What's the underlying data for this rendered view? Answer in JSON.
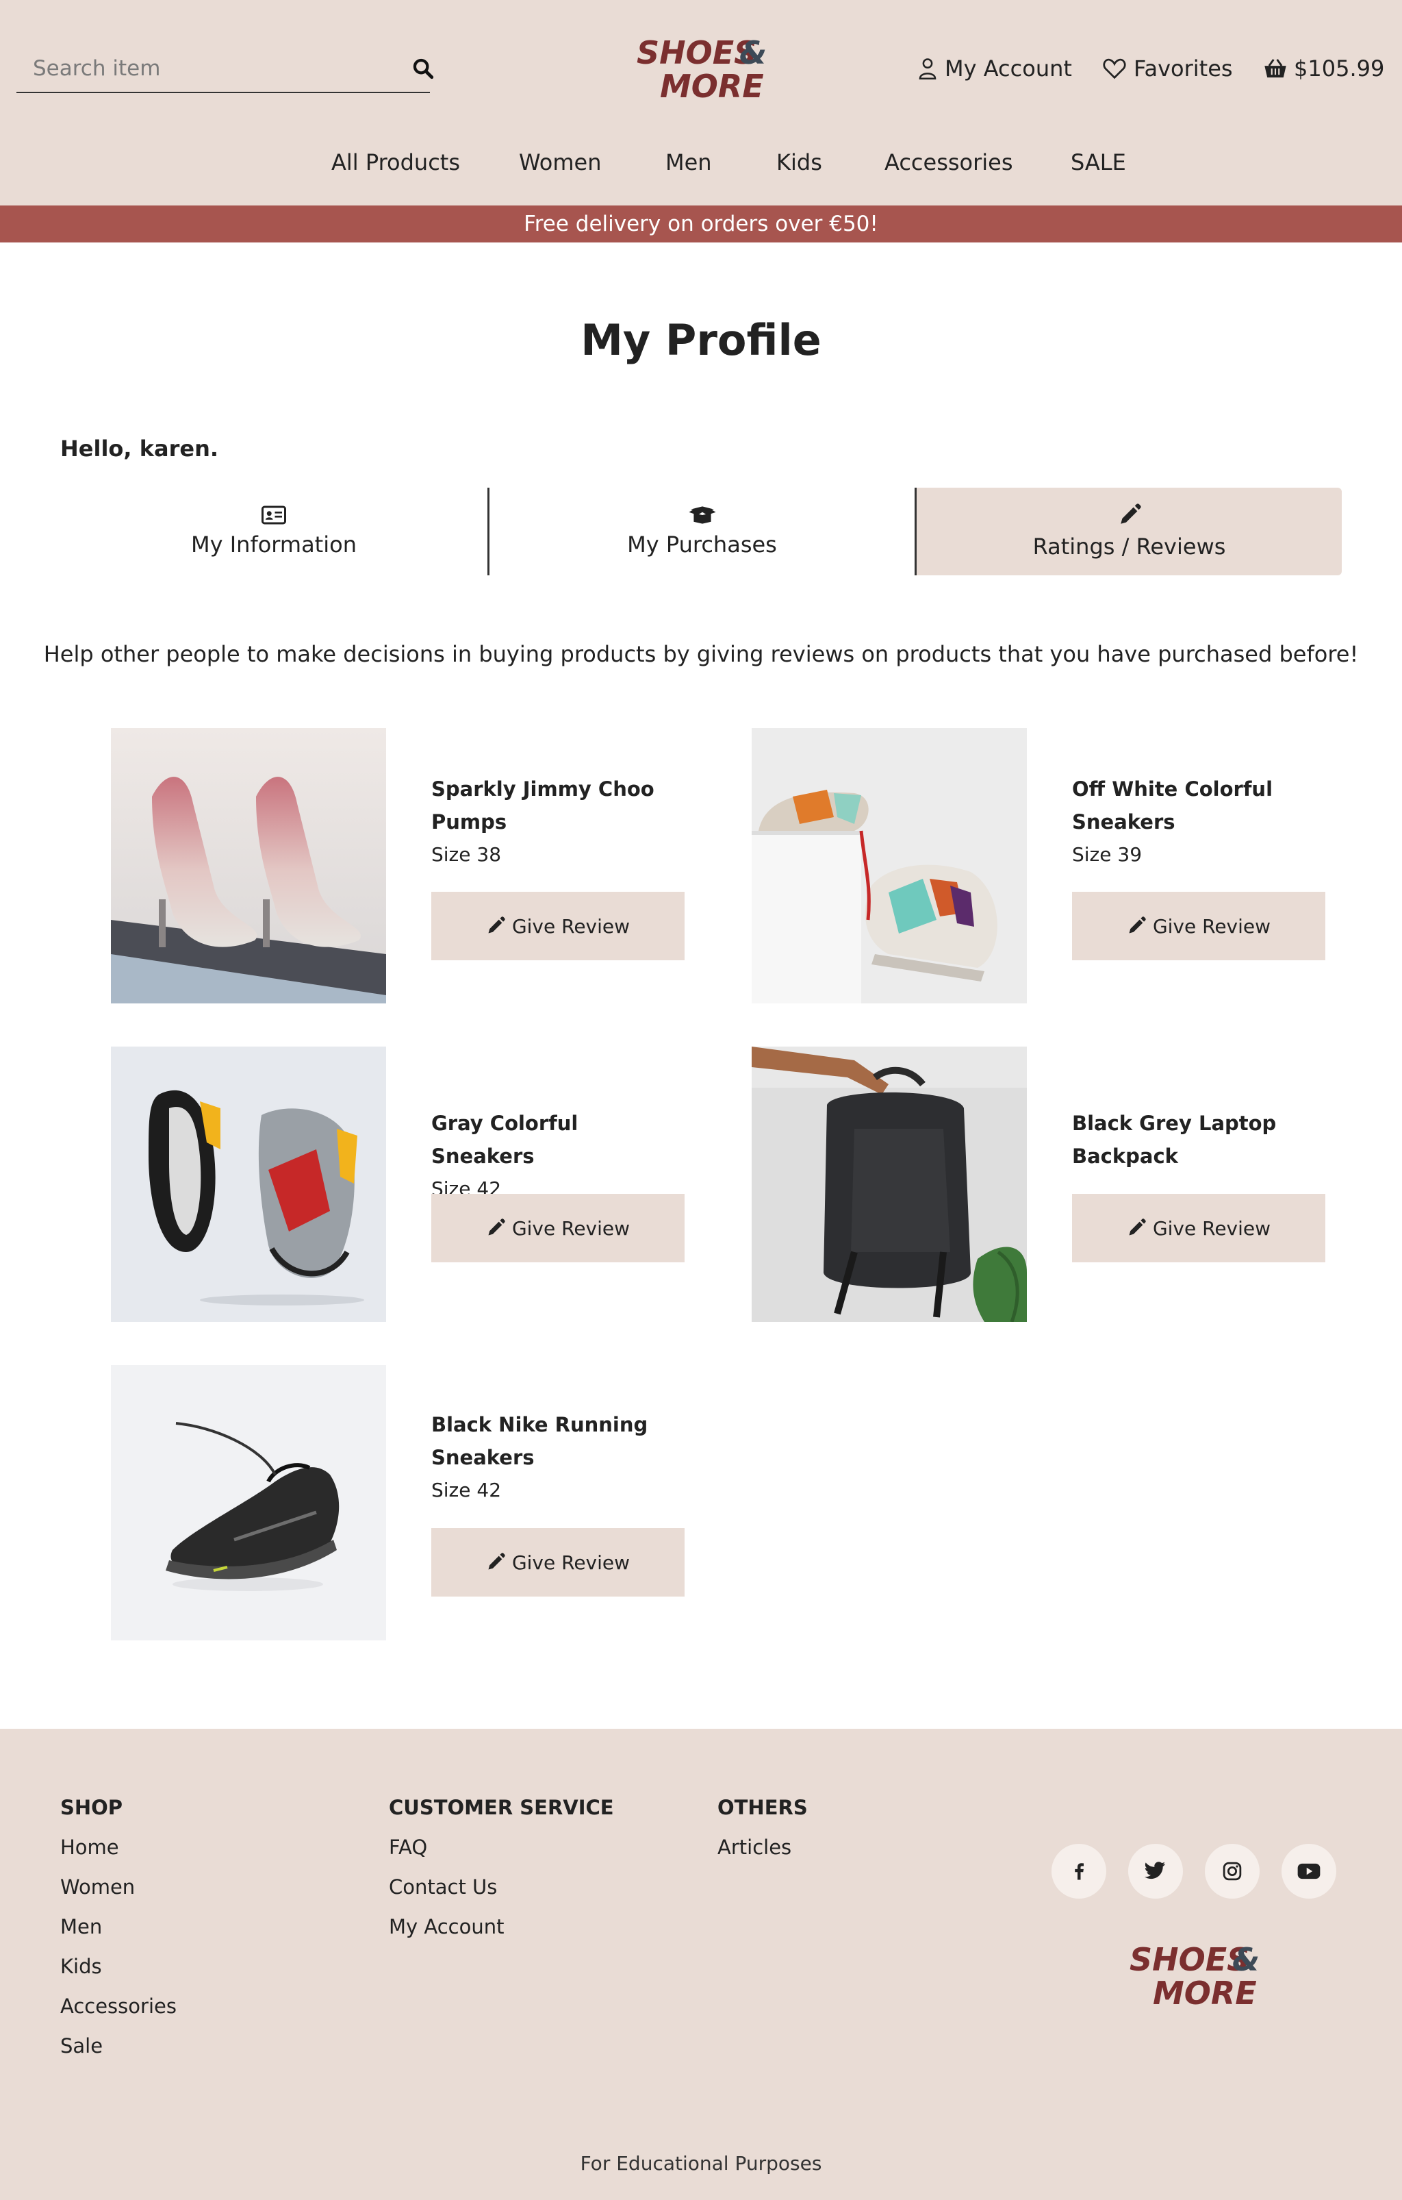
{
  "brand": {
    "logo_line1": "SHOES",
    "logo_amp": "&",
    "logo_line2": "MORE",
    "color_primary": "#7b2f2f",
    "color_accent": "#3d4a57"
  },
  "header": {
    "search_placeholder": "Search item",
    "search_icon": "search-icon",
    "account_label": "My Account",
    "favorites_label": "Favorites",
    "cart_total": "$105.99"
  },
  "nav": {
    "items": [
      {
        "label": "All Products"
      },
      {
        "label": "Women"
      },
      {
        "label": "Men"
      },
      {
        "label": "Kids"
      },
      {
        "label": "Accessories"
      },
      {
        "label": "SALE"
      }
    ]
  },
  "promo": {
    "text": "Free delivery on orders over €50!",
    "color": "#a7554f"
  },
  "profile": {
    "title": "My Profile",
    "greeting": "Hello, karen.",
    "tabs": [
      {
        "label": "My Information",
        "icon": "id-card-icon"
      },
      {
        "label": "My Purchases",
        "icon": "box-open-icon"
      },
      {
        "label": "Ratings / Reviews",
        "icon": "pencil-icon",
        "active": true
      }
    ],
    "intro": "Help other people to make decisions in buying products by giving reviews on products that you have purchased before!"
  },
  "products": [
    {
      "name": "Sparkly Jimmy Choo Pumps",
      "size": "Size 38",
      "button": "Give Review",
      "image": "glitter-pumps-image"
    },
    {
      "name": "Off White Colorful Sneakers",
      "size": "Size 39",
      "button": "Give Review",
      "image": "colorful-sneakers-image"
    },
    {
      "name": "Gray Colorful Sneakers",
      "size": "Size 42",
      "button": "Give Review",
      "image": "gray-sneakers-image"
    },
    {
      "name": "Black Grey Laptop Backpack",
      "size": "",
      "button": "Give Review",
      "image": "backpack-image"
    },
    {
      "name": "Black Nike Running Sneakers",
      "size": "Size 42",
      "button": "Give Review",
      "image": "nike-sneaker-image"
    }
  ],
  "footer": {
    "shop": {
      "heading": "SHOP",
      "links": [
        "Home",
        "Women",
        "Men",
        "Kids",
        "Accessories",
        "Sale"
      ]
    },
    "service": {
      "heading": "CUSTOMER SERVICE",
      "links": [
        "FAQ",
        "Contact Us",
        "My Account"
      ]
    },
    "others": {
      "heading": "OTHERS",
      "links": [
        "Articles"
      ]
    },
    "social": [
      "facebook-icon",
      "twitter-icon",
      "instagram-icon",
      "youtube-icon"
    ],
    "note": "For Educational Purposes"
  }
}
